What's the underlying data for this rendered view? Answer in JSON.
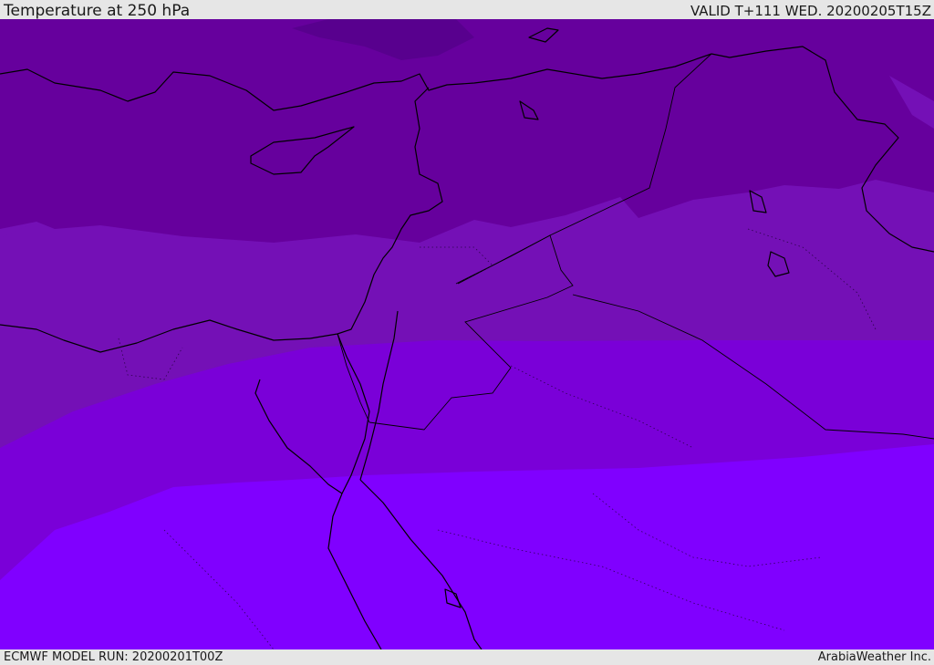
{
  "header": {
    "title": "Temperature at 250 hPa",
    "valid": "VALID T+111 WED. 20200205T15Z"
  },
  "footer": {
    "model_run": "ECMWF MODEL RUN: 20200201T00Z",
    "credit": "ArabiaWeather Inc."
  },
  "map": {
    "field": "temperature_250hPa",
    "colors": {
      "band_darkest": "#5a0090",
      "band_dark": "#66009d",
      "band_mid": "#7410b6",
      "band_light": "#7a00d8",
      "band_lighter": "#7d00f2",
      "band_lightest": "#8000ff",
      "coastline": "#000000"
    }
  }
}
